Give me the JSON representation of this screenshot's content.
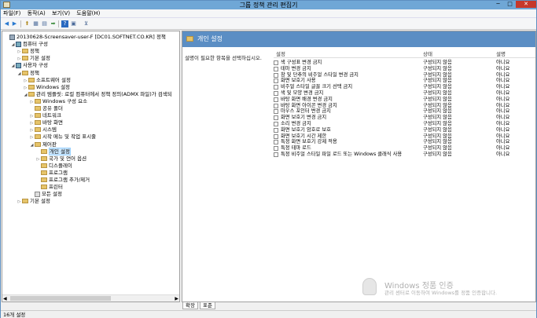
{
  "window": {
    "title": "그룹 정책 관리 편집기",
    "min": "─",
    "max": "□",
    "close": "✕"
  },
  "menu": [
    "파일(F)",
    "동작(A)",
    "보기(V)",
    "도움말(H)"
  ],
  "toolbar": {
    "back": "◀",
    "forward": "▶",
    "up": "⬆",
    "view": "▦",
    "properties": "▤",
    "export": "➡",
    "help": "?",
    "help2": "▣",
    "filter": "⊻"
  },
  "tree": [
    {
      "label": "20130628-Screensaver-user-F [DC01.SOFTNET.CO.KR] 정책",
      "level": 0,
      "exp": "",
      "icon": "policy-icon"
    },
    {
      "label": "컴퓨터 구성",
      "level": 1,
      "exp": "◢",
      "icon": "computer-icon"
    },
    {
      "label": "정책",
      "level": 2,
      "exp": "▷",
      "icon": "folder-icon"
    },
    {
      "label": "기본 설정",
      "level": 2,
      "exp": "▷",
      "icon": "folder-icon"
    },
    {
      "label": "사용자 구성",
      "level": 1,
      "exp": "◢",
      "icon": "user-icon"
    },
    {
      "label": "정책",
      "level": 2,
      "exp": "◢",
      "icon": "folder-icon"
    },
    {
      "label": "소프트웨어 설정",
      "level": 3,
      "exp": "▷",
      "icon": "folder-icon"
    },
    {
      "label": "Windows 설정",
      "level": 3,
      "exp": "▷",
      "icon": "folder-icon"
    },
    {
      "label": "관리 템플릿: 로컬 컴퓨터에서 정책 정의(ADMX 파일)가 검색되",
      "level": 3,
      "exp": "◢",
      "icon": "folder-icon"
    },
    {
      "label": "Windows 구성 요소",
      "level": 4,
      "exp": "▷",
      "icon": "folder-icon"
    },
    {
      "label": "공유 폴더",
      "level": 4,
      "exp": "",
      "icon": "folder-icon"
    },
    {
      "label": "네트워크",
      "level": 4,
      "exp": "▷",
      "icon": "folder-icon"
    },
    {
      "label": "바탕 화면",
      "level": 4,
      "exp": "▷",
      "icon": "folder-icon"
    },
    {
      "label": "시스템",
      "level": 4,
      "exp": "▷",
      "icon": "folder-icon"
    },
    {
      "label": "시작 메뉴 및 작업 표시줄",
      "level": 4,
      "exp": "▷",
      "icon": "folder-icon"
    },
    {
      "label": "제어판",
      "level": 4,
      "exp": "◢",
      "icon": "folder-icon"
    },
    {
      "label": "개인 설정",
      "level": 5,
      "exp": "",
      "icon": "folder-icon",
      "selected": true
    },
    {
      "label": "국가 및 언어 옵션",
      "level": 5,
      "exp": "▷",
      "icon": "folder-icon"
    },
    {
      "label": "디스플레이",
      "level": 5,
      "exp": "",
      "icon": "folder-icon"
    },
    {
      "label": "프로그램",
      "level": 5,
      "exp": "",
      "icon": "folder-icon"
    },
    {
      "label": "프로그램 추가/제거",
      "level": 5,
      "exp": "",
      "icon": "folder-icon"
    },
    {
      "label": "프린터",
      "level": 5,
      "exp": "",
      "icon": "folder-icon"
    },
    {
      "label": "모든 설정",
      "level": 4,
      "exp": "",
      "icon": "settings-icon"
    },
    {
      "label": "기본 설정",
      "level": 2,
      "exp": "▷",
      "icon": "folder-icon"
    }
  ],
  "right": {
    "header": "개인 설정",
    "description": "설명이 필요한 항목을 선택하십시오.",
    "columns": {
      "name": "설정",
      "state": "상태",
      "comment": "설명"
    },
    "rows": [
      {
        "name": "색 구성표 변경 금지",
        "state": "구성되지 않음",
        "comment": "아니요"
      },
      {
        "name": "테마 변경 금지",
        "state": "구성되지 않음",
        "comment": "아니요"
      },
      {
        "name": "창 및 단추의 비주얼 스타일 변경 금지",
        "state": "구성되지 않음",
        "comment": "아니요"
      },
      {
        "name": "화면 보호기 사용",
        "state": "구성되지 않음",
        "comment": "아니요"
      },
      {
        "name": "비주얼 스타일 글꼴 크기 선택 금지",
        "state": "구성되지 않음",
        "comment": "아니요"
      },
      {
        "name": "색 및 모양 변경 금지",
        "state": "구성되지 않음",
        "comment": "아니요"
      },
      {
        "name": "바탕 화면 배경 변경 금지",
        "state": "구성되지 않음",
        "comment": "아니요"
      },
      {
        "name": "바탕 화면 아이콘 변경 금지",
        "state": "구성되지 않음",
        "comment": "아니요"
      },
      {
        "name": "마우스 포인터 변경 금지",
        "state": "구성되지 않음",
        "comment": "아니요"
      },
      {
        "name": "화면 보호기 변경 금지",
        "state": "구성되지 않음",
        "comment": "아니요"
      },
      {
        "name": "소리 변경 금지",
        "state": "구성되지 않음",
        "comment": "아니요"
      },
      {
        "name": "화면 보호기 암호로 보호",
        "state": "구성되지 않음",
        "comment": "아니요"
      },
      {
        "name": "화면 보호기 시간 제한",
        "state": "구성되지 않음",
        "comment": "아니요"
      },
      {
        "name": "특정 화면 보호기 강제 적용",
        "state": "구성되지 않음",
        "comment": "아니요"
      },
      {
        "name": "특정 테마 로드",
        "state": "구성되지 않음",
        "comment": "아니요"
      },
      {
        "name": "특정 비주얼 스타일 파일 로드 또는 Windows 클래식 사용",
        "state": "구성되지 않음",
        "comment": "아니요"
      }
    ]
  },
  "tabs": [
    "확장",
    "표준"
  ],
  "status": "16개 설정",
  "watermark": {
    "line1": "Windows 정품 인증",
    "line2": "관리 센터로 이동하여 Windows를 정품 인증합니다."
  },
  "colors": {
    "header": "#5b8ec4",
    "titlebar": "#6fa7d6",
    "close": "#c7382a",
    "selection": "#cce8ff"
  }
}
